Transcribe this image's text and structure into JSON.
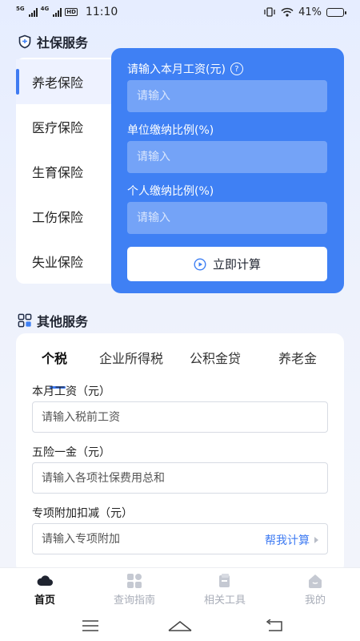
{
  "status_bar": {
    "net1": "5G",
    "net2": "4G",
    "hd": "HD",
    "time": "11:10",
    "battery": "41%",
    "battery_level": 0.41
  },
  "social_insurance": {
    "title": "社保服务",
    "items": [
      {
        "label": "养老保险",
        "active": true
      },
      {
        "label": "医疗保险",
        "active": false
      },
      {
        "label": "生育保险",
        "active": false
      },
      {
        "label": "工伤保险",
        "active": false
      },
      {
        "label": "失业保险",
        "active": false
      }
    ],
    "form": {
      "salary_label": "请输入本月工资(元)",
      "salary_placeholder": "请输入",
      "unit_ratio_label": "单位缴纳比例(%)",
      "unit_ratio_placeholder": "请输入",
      "personal_ratio_label": "个人缴纳比例(%)",
      "personal_ratio_placeholder": "请输入",
      "calc_button": "立即计算"
    }
  },
  "other_services": {
    "title": "其他服务",
    "tabs": [
      {
        "label": "个税",
        "active": true
      },
      {
        "label": "企业所得税",
        "active": false
      },
      {
        "label": "公积金贷",
        "active": false
      },
      {
        "label": "养老金",
        "active": false
      }
    ],
    "fields": {
      "salary_label": "本月工资（元）",
      "salary_placeholder": "请输入税前工资",
      "insurance_label": "五险一金（元）",
      "insurance_placeholder": "请输入各项社保费用总和",
      "deduction_label": "专项附加扣减（元）",
      "deduction_placeholder": "请输入专项附加",
      "help_link": "帮我计算"
    }
  },
  "bottom_nav": [
    {
      "label": "首页",
      "icon": "home-cloud-icon",
      "active": true
    },
    {
      "label": "查询指南",
      "icon": "grid-icon",
      "active": false
    },
    {
      "label": "相关工具",
      "icon": "toolbox-icon",
      "active": false
    },
    {
      "label": "我的",
      "icon": "profile-icon",
      "active": false
    }
  ],
  "colors": {
    "accent": "#3f80f4",
    "link": "#3f7bf2",
    "inactive_nav": "#a8adb8"
  }
}
